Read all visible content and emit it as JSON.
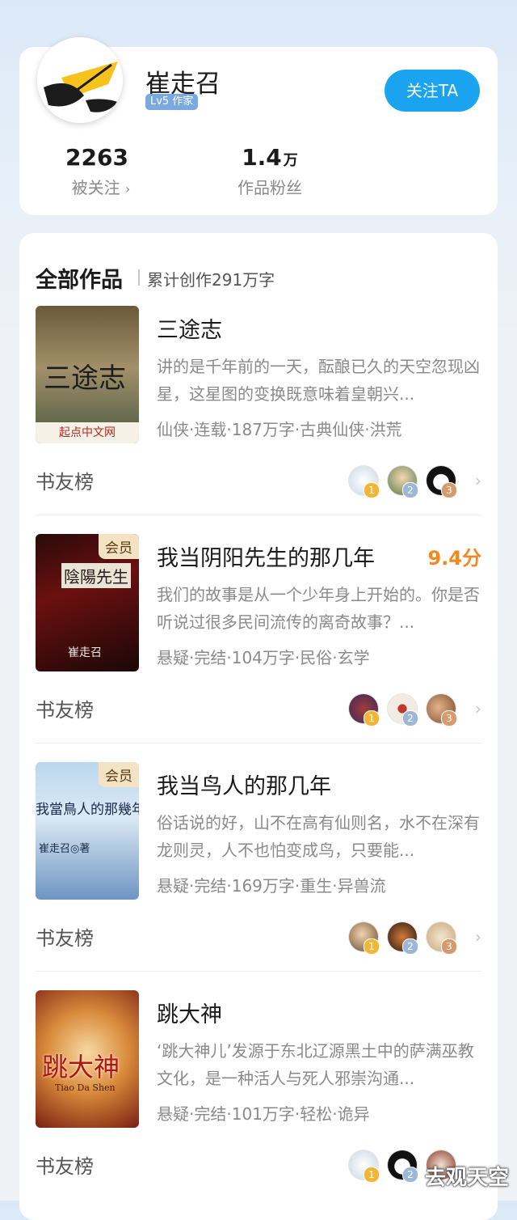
{
  "author": {
    "name": "崔走召",
    "level": "Lv5 作家",
    "follow_label": "关注TA",
    "followers_count": "2263",
    "followers_label": "被关注",
    "fans_count": "1.4",
    "fans_unit": "万",
    "fans_label": "作品粉丝"
  },
  "works": {
    "title": "全部作品",
    "total_words": "累计创作291万字",
    "rank_label": "书友榜",
    "books": [
      {
        "title": "三途志",
        "description": "讲的是千年前的一天，酝酿已久的天空忽现凶星，这星图的变换既意味着皇朝兴...",
        "meta": "仙侠·连载·187万字·古典仙侠·洪荒",
        "vip": "",
        "score": "",
        "cover_text": "三途志",
        "cover_footer": "起点中文网"
      },
      {
        "title": "我当阴阳先生的那几年",
        "description": "我们的故事是从一个少年身上开始的。你是否听说过很多民间流传的离奇故事？...",
        "meta": "悬疑·完结·104万字·民俗·玄学",
        "vip": "会员",
        "score": "9.4分",
        "cover_text": "陰陽先生",
        "cover_footer": "崔走召"
      },
      {
        "title": "我当鸟人的那几年",
        "description": "俗话说的好，山不在高有仙则名，水不在深有龙则灵，人不也怕变成鸟，只要能...",
        "meta": "悬疑·完结·169万字·重生·异兽流",
        "vip": "会员",
        "score": "",
        "cover_text": "我當鳥人的那幾年",
        "cover_footer": "崔走召◎著"
      },
      {
        "title": "跳大神",
        "description": "‘跳大神儿’发源于东北辽源黑土中的萨满巫教文化，是一种活人与死人邪崇沟通...",
        "meta": "悬疑·完结·101万字·轻松·诡异",
        "vip": "",
        "score": "",
        "cover_text": "跳大神",
        "cover_footer": "Tiao Da Shen"
      }
    ]
  },
  "rank_numbers": [
    "1",
    "2",
    "3"
  ],
  "colors": {
    "accent": "#1aa3ee",
    "score": "#f08a1e",
    "rank1": "#f2b634",
    "rank2": "#9db8d6",
    "rank3": "#d69a6c"
  },
  "icons": [
    "quill-logo-icon",
    "chevron-right-icon"
  ],
  "watermark": "去观天空"
}
